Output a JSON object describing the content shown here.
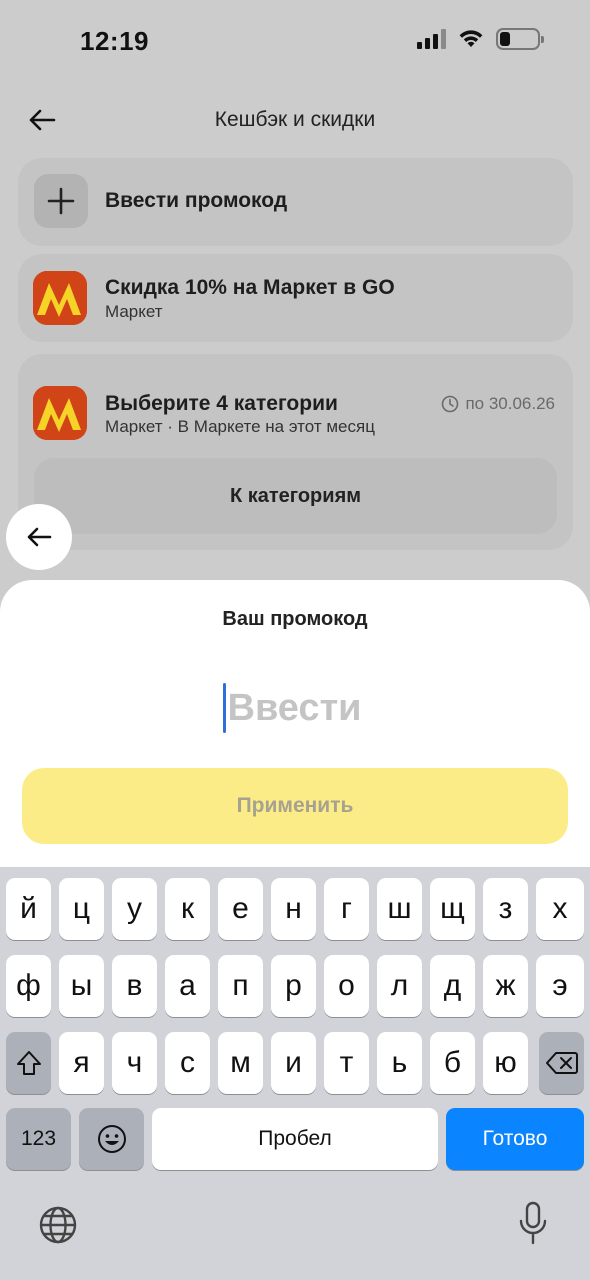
{
  "status_bar": {
    "time": "12:19"
  },
  "header": {
    "title": "Кешбэк и скидки"
  },
  "cards": {
    "promo": {
      "label": "Ввести промокод"
    },
    "discount": {
      "title": "Скидка 10% на Маркет в GO",
      "subtitle": "Маркет"
    },
    "categories": {
      "title": "Выберите 4 категории",
      "subtitle": "Маркет · В Маркете на этот месяц",
      "deadline": "по 30.06.26",
      "button_label": "К категориям"
    }
  },
  "sheet": {
    "title": "Ваш промокод",
    "input_placeholder": "Ввести",
    "input_value": "",
    "apply_label": "Применить"
  },
  "keyboard": {
    "row1": [
      "й",
      "ц",
      "у",
      "к",
      "е",
      "н",
      "г",
      "ш",
      "щ",
      "з",
      "х"
    ],
    "row2": [
      "ф",
      "ы",
      "в",
      "а",
      "п",
      "р",
      "о",
      "л",
      "д",
      "ж",
      "э"
    ],
    "row3": [
      "я",
      "ч",
      "с",
      "м",
      "и",
      "т",
      "ь",
      "б",
      "ю"
    ],
    "numbers_label": "123",
    "space_label": "Пробел",
    "done_label": "Готово"
  },
  "colors": {
    "accent_yellow": "#fbec88",
    "done_blue": "#0a84ff",
    "caret_blue": "#2f6fdc",
    "market_red": "#d04417",
    "market_yellow": "#f5d327"
  }
}
